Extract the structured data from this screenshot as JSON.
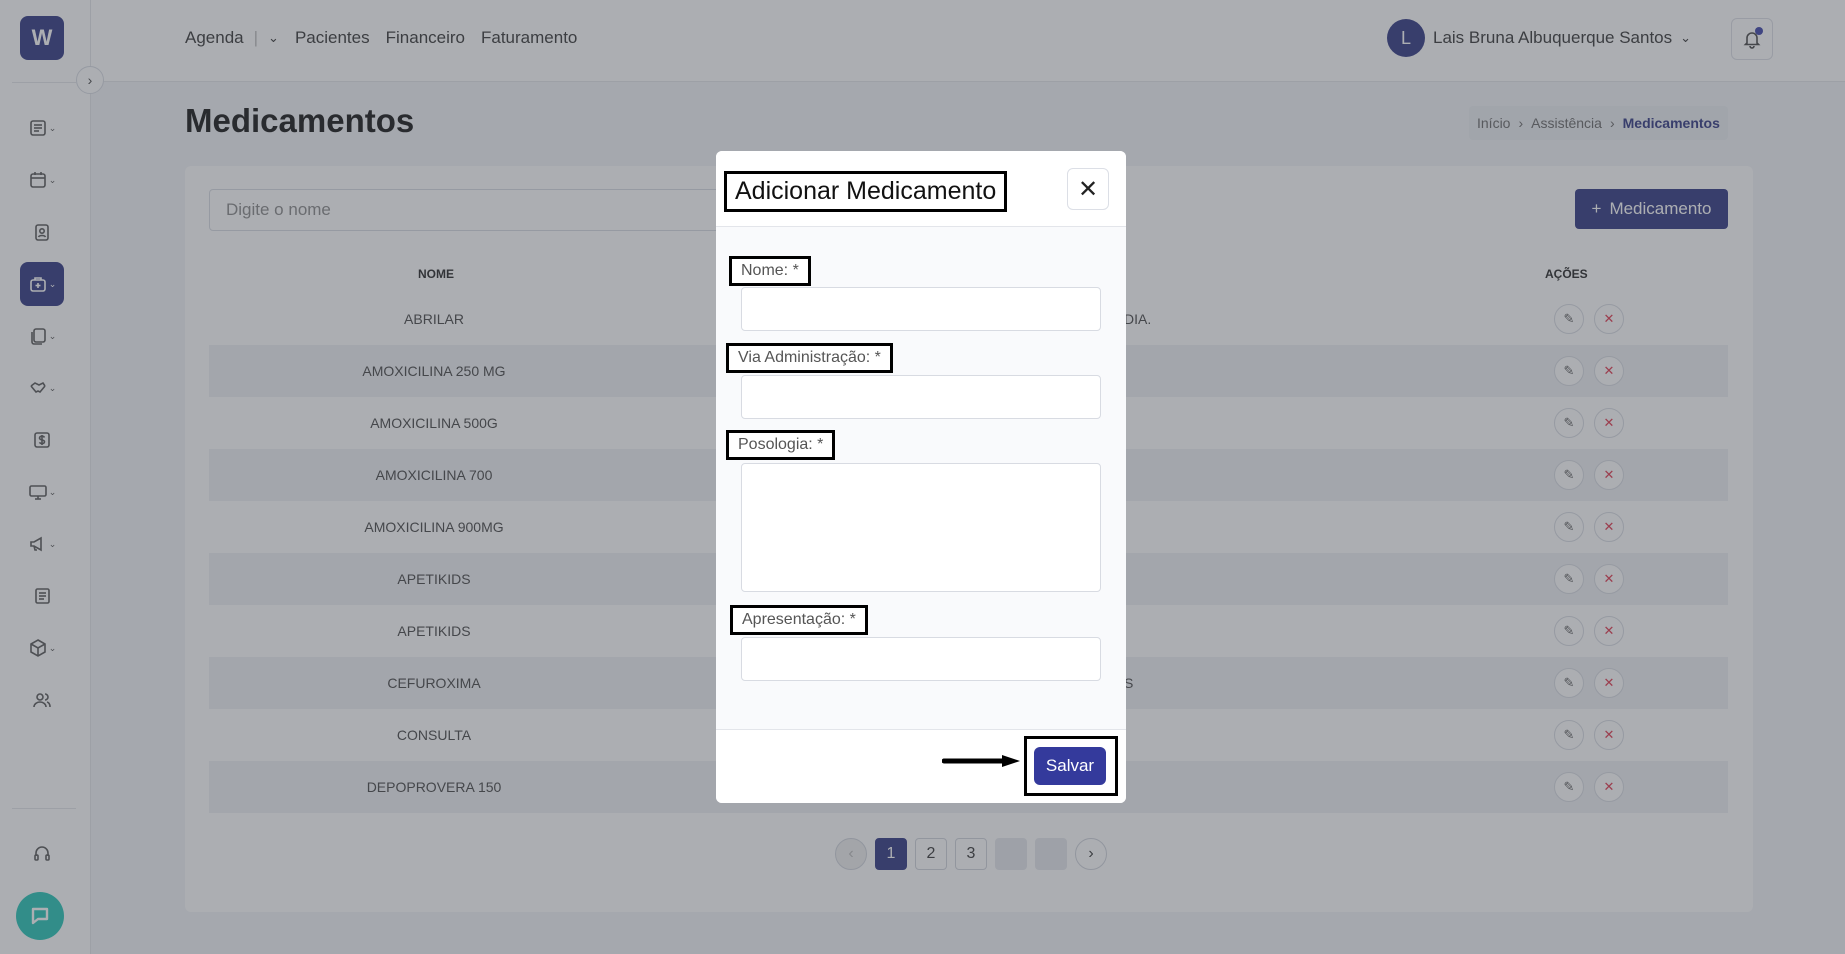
{
  "nav": {
    "agenda": "Agenda",
    "pacientes": "Pacientes",
    "financeiro": "Financeiro",
    "faturamento": "Faturamento"
  },
  "user": {
    "initial": "L",
    "name": "Lais Bruna Albuquerque Santos"
  },
  "page": {
    "title": "Medicamentos"
  },
  "breadcrumb": [
    "Início",
    "Assistência",
    "Medicamentos"
  ],
  "search": {
    "placeholder": "Digite o nome"
  },
  "add_button": "Medicamento",
  "table": {
    "headers": {
      "nome": "NOME",
      "acoes": "AÇÕES"
    },
    "rows": [
      {
        "name": "ABRILAR",
        "mid": "DIA."
      },
      {
        "name": "AMOXICILINA 250 MG",
        "mid": ""
      },
      {
        "name": "AMOXICILINA 500G",
        "mid": ""
      },
      {
        "name": "AMOXICILINA 700",
        "mid": ""
      },
      {
        "name": "AMOXICILINA 900MG",
        "mid": ""
      },
      {
        "name": "APETIKIDS",
        "mid": ""
      },
      {
        "name": "APETIKIDS",
        "mid": ""
      },
      {
        "name": "CEFUROXIMA",
        "mid": "S"
      },
      {
        "name": "CONSULTA",
        "mid": ""
      },
      {
        "name": "DEPOPROVERA 150",
        "mid": ""
      }
    ]
  },
  "pagination": {
    "pages": [
      "1",
      "2",
      "3"
    ],
    "current": "1"
  },
  "modal": {
    "title": "Adicionar Medicamento",
    "fields": {
      "nome": "Nome: *",
      "via": "Via Administração: *",
      "posologia": "Posologia: *",
      "apresentacao": "Apresentação: *"
    },
    "save": "Salvar"
  },
  "colors": {
    "primary": "#2d3480",
    "danger": "#e0334a",
    "chat": "#21c4b4"
  }
}
